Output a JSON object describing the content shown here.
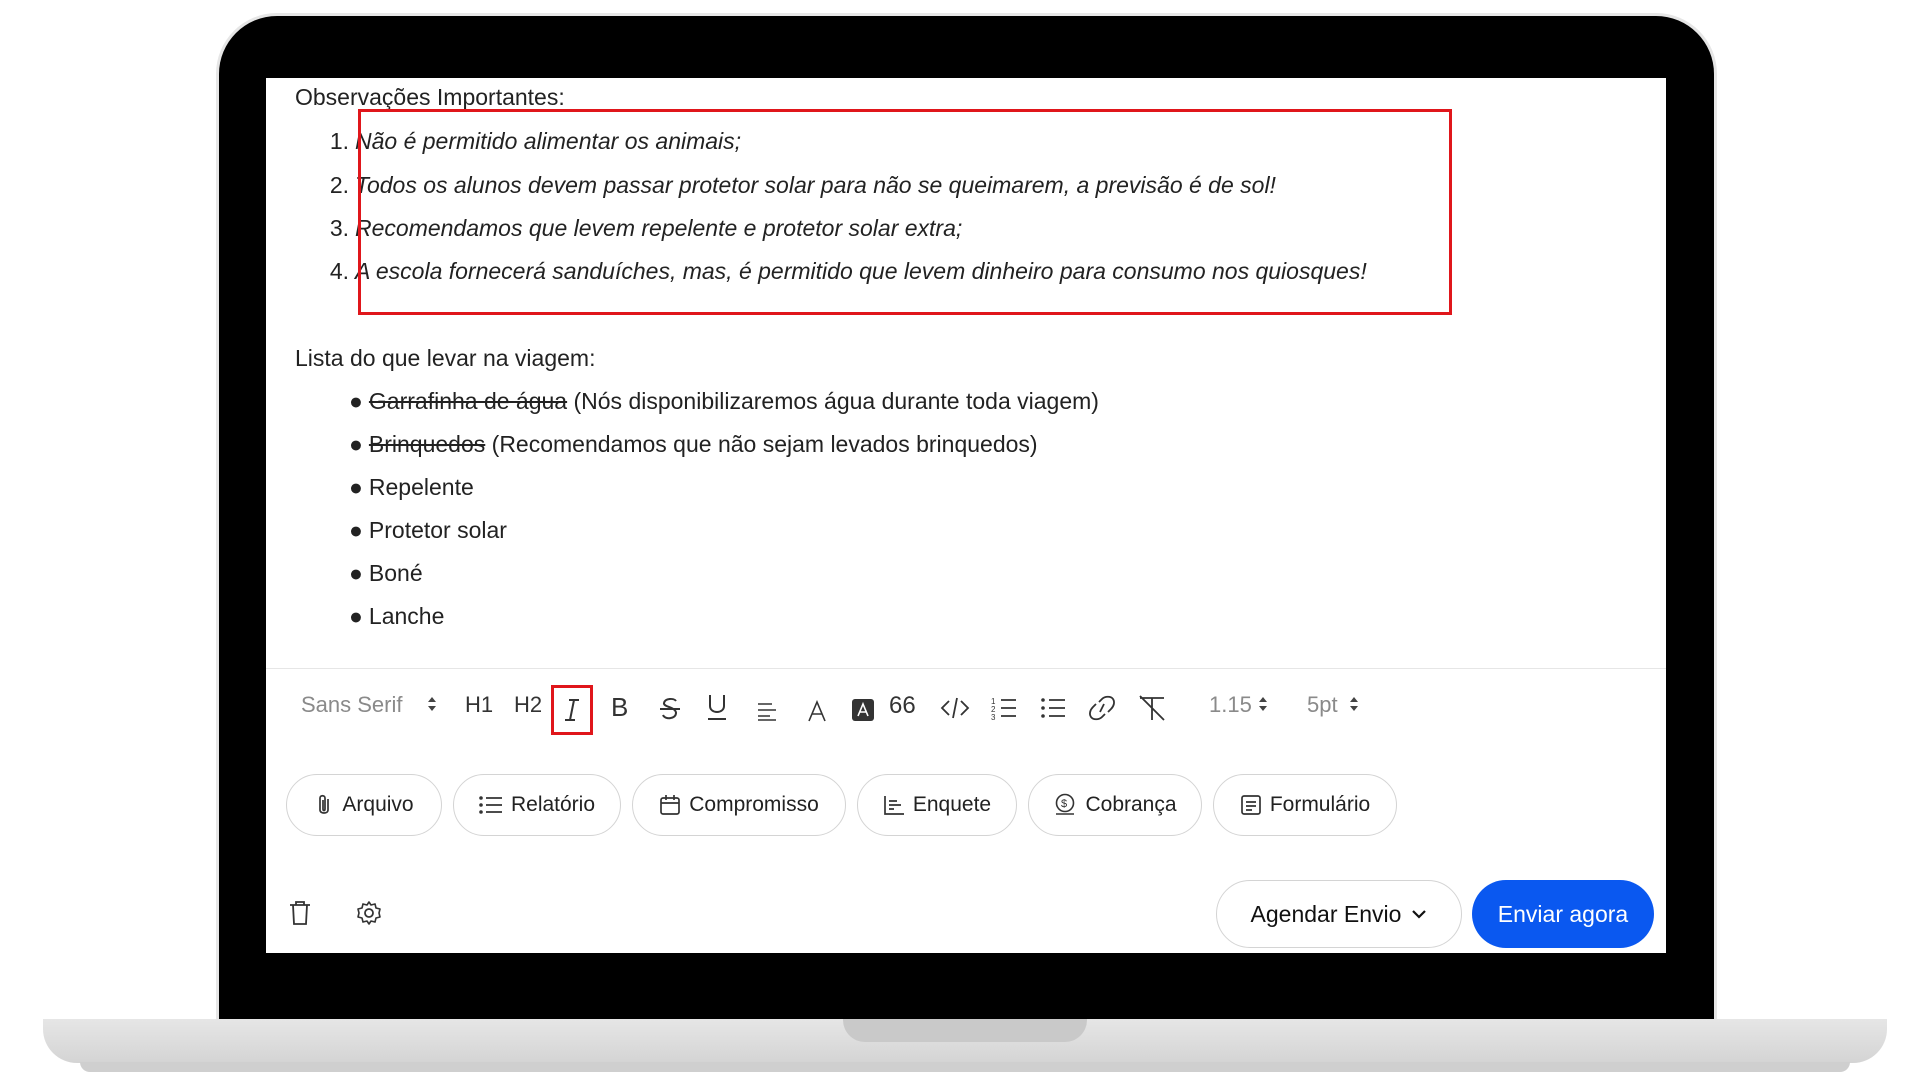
{
  "editor": {
    "heading_obs": "Observações Importantes:",
    "ordered_items": [
      {
        "num": "1.",
        "text": "Não é permitido alimentar os animais;"
      },
      {
        "num": "2.",
        "text": "Todos os alunos devem passar protetor solar para não se queimarem, a previsão é de sol!"
      },
      {
        "num": "3.",
        "text": "Recomendamos que levem repelente e protetor solar extra;"
      },
      {
        "num": "4.",
        "text": "A escola fornecerá sanduíches, mas, é permitido que levem dinheiro para consumo nos quiosques!"
      }
    ],
    "heading_list": "Lista do que levar na viagem:",
    "bullet_items": [
      {
        "strike": "Garrafinha de água",
        "rest": " (Nós disponibilizaremos água durante toda viagem)"
      },
      {
        "strike": "Brinquedos",
        "rest": " (Recomendamos que não sejam levados brinquedos)"
      },
      {
        "strike": "",
        "rest": "Repelente"
      },
      {
        "strike": "",
        "rest": "Protetor solar"
      },
      {
        "strike": "",
        "rest": "Boné"
      },
      {
        "strike": "",
        "rest": "Lanche"
      }
    ]
  },
  "toolbar": {
    "font_select": "Sans Serif",
    "h1": "H1",
    "h2": "H2",
    "bold": "B",
    "underline": "U",
    "quote": "66",
    "line_height": "1.15",
    "font_size": "5pt",
    "icons": [
      "italic-icon",
      "bold-icon",
      "strikethrough-icon",
      "underline-icon",
      "align-left-icon",
      "text-color-icon",
      "highlight-icon",
      "quote-icon",
      "code-icon",
      "ordered-list-icon",
      "bullet-list-icon",
      "link-icon",
      "clear-format-icon"
    ]
  },
  "chips": {
    "arquivo": "Arquivo",
    "relatorio": "Relatório",
    "compromisso": "Compromisso",
    "enquete": "Enquete",
    "cobranca": "Cobrança",
    "formulario": "Formulário"
  },
  "actions": {
    "agendar": "Agendar Envio",
    "enviar": "Enviar agora"
  },
  "colors": {
    "highlight_border": "#e0161b",
    "primary_button": "#0a58f0"
  }
}
